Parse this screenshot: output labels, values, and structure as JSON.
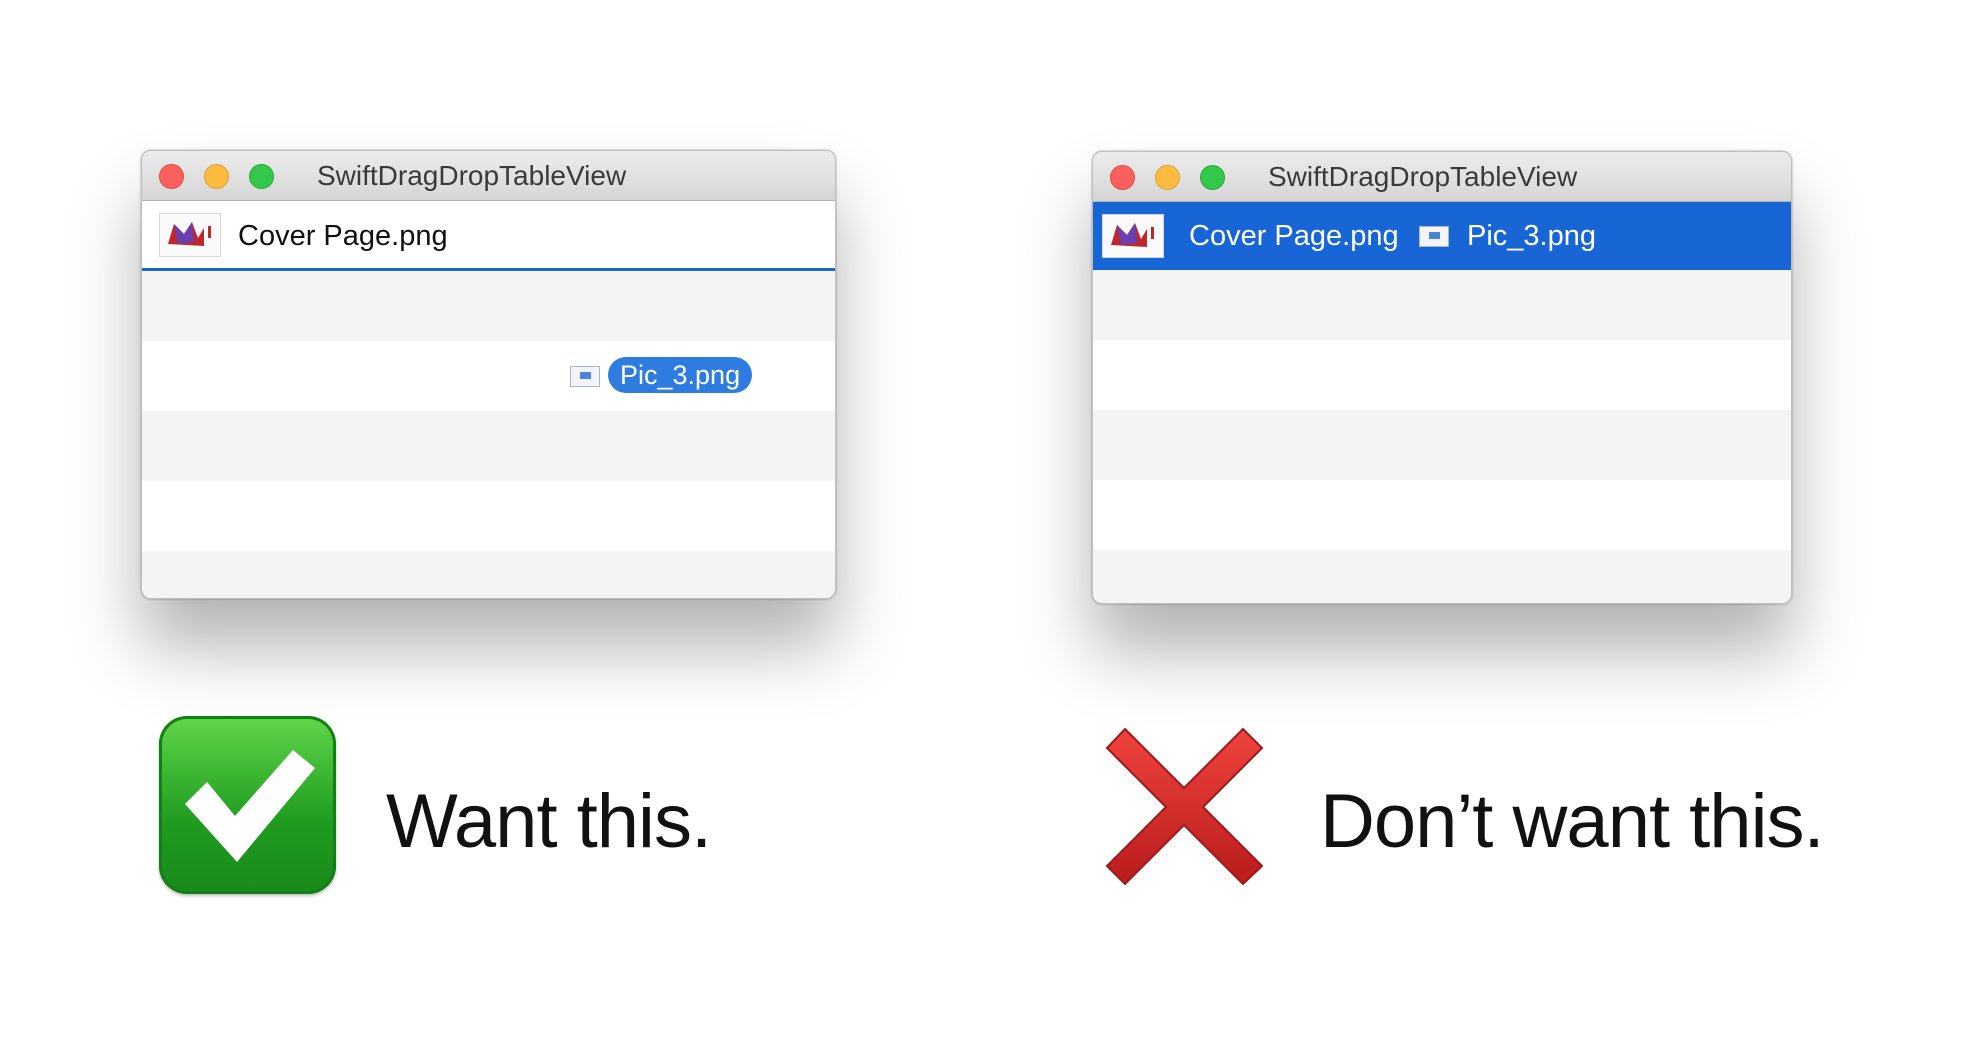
{
  "left_window": {
    "title": "SwiftDragDropTableView",
    "rows": [
      {
        "label": "Cover Page.png"
      },
      {
        "label": ""
      },
      {
        "label": ""
      },
      {
        "label": ""
      },
      {
        "label": ""
      }
    ],
    "drag_label": "Pic_3.png",
    "thumb_icon": "image-thumbnail-icon",
    "drag_icon": "image-file-icon"
  },
  "right_window": {
    "title": "SwiftDragDropTableView",
    "selected_row": {
      "label": "Cover Page.png",
      "appended_label": "Pic_3.png"
    },
    "row_count": 5
  },
  "captions": {
    "good": "Want this.",
    "bad": "Don’t want this.",
    "good_icon": "checkmark-icon",
    "bad_icon": "cross-icon"
  },
  "colors": {
    "selection": "#1866d6",
    "drop_indicator": "#1c66d0",
    "drag_pill": "#2f7ce0",
    "check_green": "#1f9b1f",
    "cross_red": "#d42020"
  }
}
